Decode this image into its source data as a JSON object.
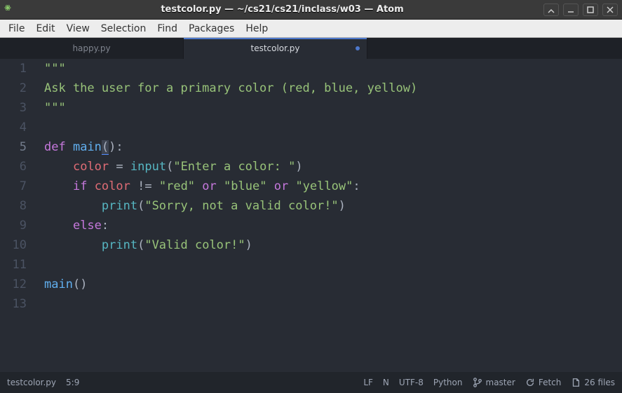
{
  "window": {
    "title": "testcolor.py — ~/cs21/cs21/inclass/w03 — Atom"
  },
  "menu": {
    "items": [
      "File",
      "Edit",
      "View",
      "Selection",
      "Find",
      "Packages",
      "Help"
    ]
  },
  "tabs": [
    {
      "label": "happy.py",
      "active": false,
      "modified": false
    },
    {
      "label": "testcolor.py",
      "active": true,
      "modified": true
    }
  ],
  "editor": {
    "cursor_line": 5,
    "lines": [
      [
        {
          "t": "\"\"\"",
          "c": "tok-str"
        }
      ],
      [
        {
          "t": "Ask the user for a primary color (red, blue, yellow)",
          "c": "tok-str"
        }
      ],
      [
        {
          "t": "\"\"\"",
          "c": "tok-str"
        }
      ],
      [],
      [
        {
          "t": "def ",
          "c": "tok-kw"
        },
        {
          "t": "main",
          "c": "tok-fn"
        },
        {
          "t": "(",
          "c": "tok-plain hl-paren"
        },
        {
          "t": ")",
          "c": "tok-plain"
        },
        {
          "t": ":",
          "c": "tok-plain"
        }
      ],
      [
        {
          "t": "    ",
          "c": "tok-plain"
        },
        {
          "t": "color",
          "c": "tok-var"
        },
        {
          "t": " ",
          "c": "tok-plain"
        },
        {
          "t": "=",
          "c": "tok-op"
        },
        {
          "t": " ",
          "c": "tok-plain"
        },
        {
          "t": "input",
          "c": "tok-call"
        },
        {
          "t": "(",
          "c": "tok-plain"
        },
        {
          "t": "\"Enter a color: \"",
          "c": "tok-str"
        },
        {
          "t": ")",
          "c": "tok-plain"
        }
      ],
      [
        {
          "t": "    ",
          "c": "tok-plain"
        },
        {
          "t": "if",
          "c": "tok-kw"
        },
        {
          "t": " ",
          "c": "tok-plain"
        },
        {
          "t": "color",
          "c": "tok-var"
        },
        {
          "t": " ",
          "c": "tok-plain"
        },
        {
          "t": "!=",
          "c": "tok-op"
        },
        {
          "t": " ",
          "c": "tok-plain"
        },
        {
          "t": "\"red\"",
          "c": "tok-str"
        },
        {
          "t": " ",
          "c": "tok-plain"
        },
        {
          "t": "or",
          "c": "tok-kw"
        },
        {
          "t": " ",
          "c": "tok-plain"
        },
        {
          "t": "\"blue\"",
          "c": "tok-str"
        },
        {
          "t": " ",
          "c": "tok-plain"
        },
        {
          "t": "or",
          "c": "tok-kw"
        },
        {
          "t": " ",
          "c": "tok-plain"
        },
        {
          "t": "\"yellow\"",
          "c": "tok-str"
        },
        {
          "t": ":",
          "c": "tok-plain"
        }
      ],
      [
        {
          "t": "        ",
          "c": "tok-plain"
        },
        {
          "t": "print",
          "c": "tok-call"
        },
        {
          "t": "(",
          "c": "tok-plain"
        },
        {
          "t": "\"Sorry, not a valid color!\"",
          "c": "tok-str"
        },
        {
          "t": ")",
          "c": "tok-plain"
        }
      ],
      [
        {
          "t": "    ",
          "c": "tok-plain"
        },
        {
          "t": "else",
          "c": "tok-kw"
        },
        {
          "t": ":",
          "c": "tok-plain"
        }
      ],
      [
        {
          "t": "        ",
          "c": "tok-plain"
        },
        {
          "t": "print",
          "c": "tok-call"
        },
        {
          "t": "(",
          "c": "tok-plain"
        },
        {
          "t": "\"Valid color!\"",
          "c": "tok-str"
        },
        {
          "t": ")",
          "c": "tok-plain"
        }
      ],
      [],
      [
        {
          "t": "main",
          "c": "tok-fn"
        },
        {
          "t": "()",
          "c": "tok-plain"
        }
      ],
      []
    ]
  },
  "status": {
    "filename": "testcolor.py",
    "cursor": "5:9",
    "line_ending": "LF",
    "modified_flag": "N",
    "encoding": "UTF-8",
    "language": "Python",
    "branch": "master",
    "fetch": "Fetch",
    "files": "26 files"
  }
}
